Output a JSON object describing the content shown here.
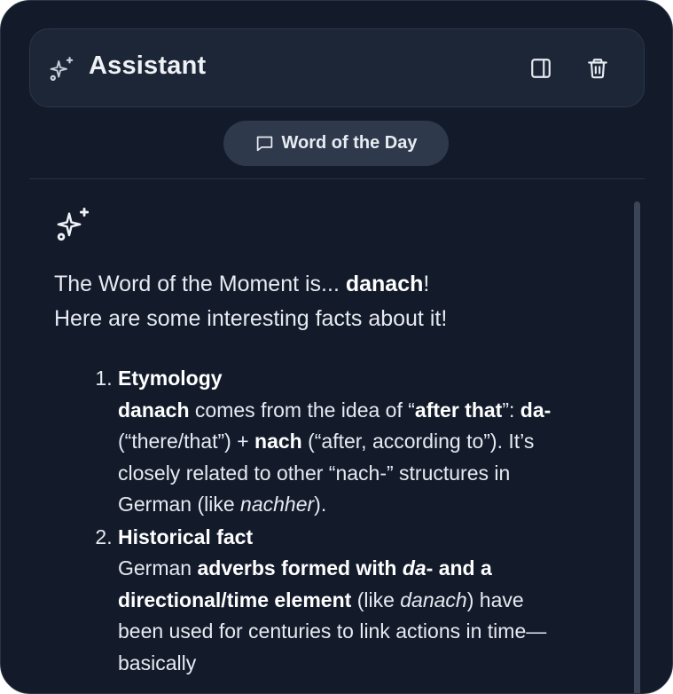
{
  "header": {
    "title": "Assistant",
    "icons": [
      "sparkles-icon",
      "sidebar-toggle-icon",
      "trash-icon"
    ]
  },
  "chip": {
    "label": "Word of the Day",
    "icon": "message-square-icon"
  },
  "message": {
    "icon": "sparkles-icon",
    "intro_prefix": "The Word of the Moment is... ",
    "word": "danach",
    "intro_suffix": "!",
    "intro_line2": "Here are some interesting facts about it!",
    "facts": [
      {
        "title": "Etymology",
        "p1": "danach",
        "p2": " comes from the idea of “",
        "p3": "after that",
        "p4": "”: ",
        "p5": "da-",
        "p6": " (“there/that”) + ",
        "p7": "nach",
        "p8": " (“after, according to”). It’s closely related to other “nach-” structures in German (like ",
        "p9": "nachher",
        "p10": ")."
      },
      {
        "title": "Historical fact",
        "p1": "German ",
        "p2": "adverbs formed with ",
        "p3": "da",
        "p4": "- and a directional/time element",
        "p5": " (like ",
        "p6": "danach",
        "p7": ") have been used for centuries to link actions in time—basically"
      }
    ]
  },
  "colors": {
    "background": "#131b2b",
    "header_bg": "#1d2637",
    "chip_bg": "#2e394b",
    "text": "#e6eaf1"
  }
}
